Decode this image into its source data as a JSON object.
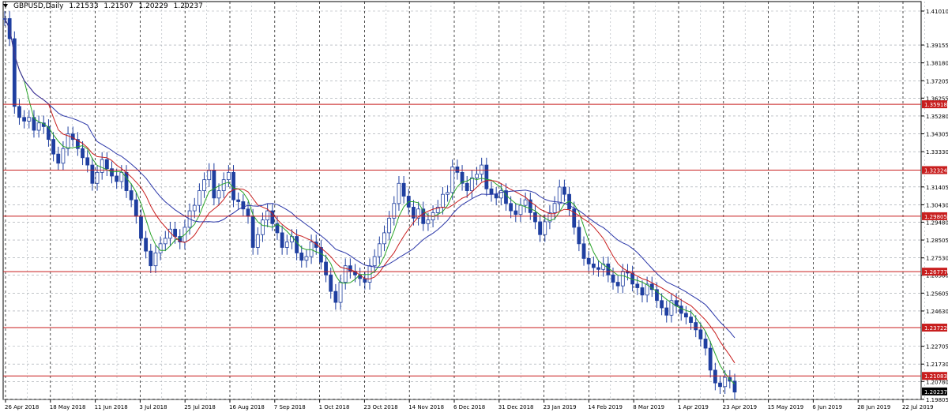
{
  "header": {
    "symbol": "GBPUSD,Daily",
    "open": "1.21533",
    "high": "1.21507",
    "low": "1.20229",
    "close": "1.20237"
  },
  "colors": {
    "background": "#ffffff",
    "grid": "#9aa0a8",
    "candles": "#1f3fa0",
    "ma_fast": "#2aa52a",
    "ma_mid": "#c81e1e",
    "ma_slow": "#2a36a8",
    "level_line": "#c81e1e",
    "level_label_bg": "#c81e1e",
    "price_label_bg": "#000000"
  },
  "chart_data": {
    "type": "candlestick",
    "title": "GBPUSD,Daily",
    "ylim": [
      1.198,
      1.4101
    ],
    "y_ticks": [
      "1.41010",
      "1.39155",
      "1.38180",
      "1.37205",
      "1.36255",
      "1.35280",
      "1.34305",
      "1.33330",
      "1.31405",
      "1.30430",
      "1.29480",
      "1.28505",
      "1.27530",
      "1.26580",
      "1.25605",
      "1.24630",
      "1.22705",
      "1.21730",
      "1.20780",
      "1.19805"
    ],
    "x_ticks": [
      "26 Apr 2018",
      "18 May 2018",
      "11 Jun 2018",
      "3 Jul 2018",
      "25 Jul 2018",
      "16 Aug 2018",
      "7 Sep 2018",
      "1 Oct 2018",
      "23 Oct 2018",
      "14 Nov 2018",
      "6 Dec 2018",
      "31 Dec 2018",
      "23 Jan 2019",
      "14 Feb 2019",
      "8 Mar 2019",
      "1 Apr 2019",
      "23 Apr 2019",
      "15 May 2019",
      "6 Jun 2019",
      "28 Jun 2019",
      "22 Jul 2019"
    ],
    "horizontal_levels": [
      "1.35918",
      "1.32324",
      "1.29805",
      "1.26777",
      "1.23722",
      "1.21083"
    ],
    "current_price": "1.20237",
    "grid": true,
    "series": [
      {
        "type": "ohlc-close-path",
        "points": [
          1.406,
          1.395,
          1.358,
          1.352,
          1.35,
          1.352,
          1.345,
          1.349,
          1.347,
          1.34,
          1.332,
          1.327,
          1.335,
          1.343,
          1.34,
          1.335,
          1.33,
          1.326,
          1.316,
          1.322,
          1.329,
          1.324,
          1.32,
          1.317,
          1.322,
          1.312,
          1.307,
          1.298,
          1.286,
          1.279,
          1.271,
          1.278,
          1.283,
          1.286,
          1.291,
          1.287,
          1.284,
          1.292,
          1.301,
          1.304,
          1.312,
          1.318,
          1.323,
          1.308,
          1.312,
          1.318,
          1.322,
          1.307,
          1.306,
          1.302,
          1.298,
          1.281,
          1.288,
          1.296,
          1.301,
          1.294,
          1.289,
          1.281,
          1.284,
          1.287,
          1.278,
          1.274,
          1.276,
          1.284,
          1.281,
          1.273,
          1.266,
          1.257,
          1.251,
          1.262,
          1.271,
          1.268,
          1.266,
          1.264,
          1.262,
          1.271,
          1.276,
          1.283,
          1.289,
          1.297,
          1.305,
          1.316,
          1.309,
          1.303,
          1.297,
          1.302,
          1.294,
          1.296,
          1.3,
          1.303,
          1.31,
          1.311,
          1.325,
          1.322,
          1.316,
          1.312,
          1.319,
          1.321,
          1.326,
          1.313,
          1.31,
          1.308,
          1.312,
          1.305,
          1.301,
          1.299,
          1.304,
          1.307,
          1.3,
          1.295,
          1.288,
          1.295,
          1.3,
          1.305,
          1.314,
          1.31,
          1.302,
          1.292,
          1.283,
          1.275,
          1.272,
          1.27,
          1.269,
          1.272,
          1.266,
          1.262,
          1.26,
          1.268,
          1.267,
          1.261,
          1.259,
          1.255,
          1.261,
          1.258,
          1.252,
          1.248,
          1.244,
          1.252,
          1.249,
          1.245,
          1.243,
          1.24,
          1.236,
          1.231,
          1.226,
          1.214,
          1.207,
          1.205,
          1.21,
          1.208,
          1.202
        ]
      },
      {
        "name": "",
        "type": "ma",
        "period_role": "fast"
      },
      {
        "name": "",
        "type": "ma",
        "period_role": "mid"
      },
      {
        "name": "",
        "type": "ma",
        "period_role": "slow"
      }
    ]
  }
}
